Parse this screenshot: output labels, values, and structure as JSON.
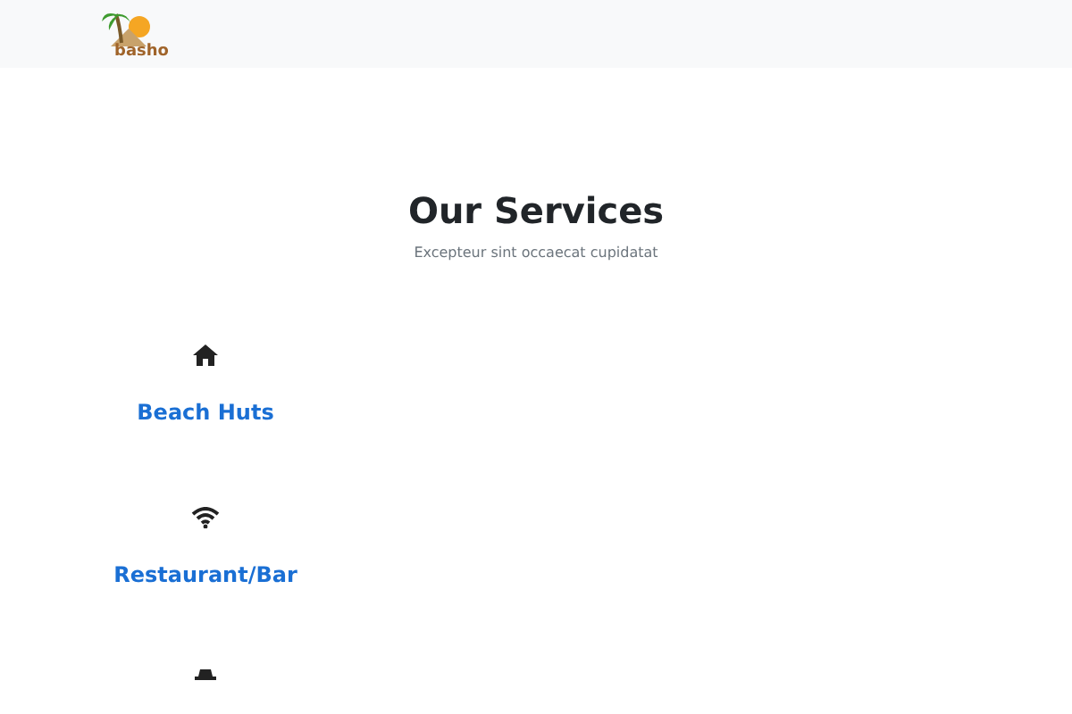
{
  "logo": {
    "text": "basho"
  },
  "section": {
    "title": "Our Services",
    "subtitle": "Excepteur sint occaecat cupidatat"
  },
  "services": [
    {
      "kind": "home",
      "title": "Beach Huts"
    },
    {
      "kind": "wifi",
      "title": "Restaurant/Bar"
    },
    {
      "kind": "hat"
    }
  ]
}
